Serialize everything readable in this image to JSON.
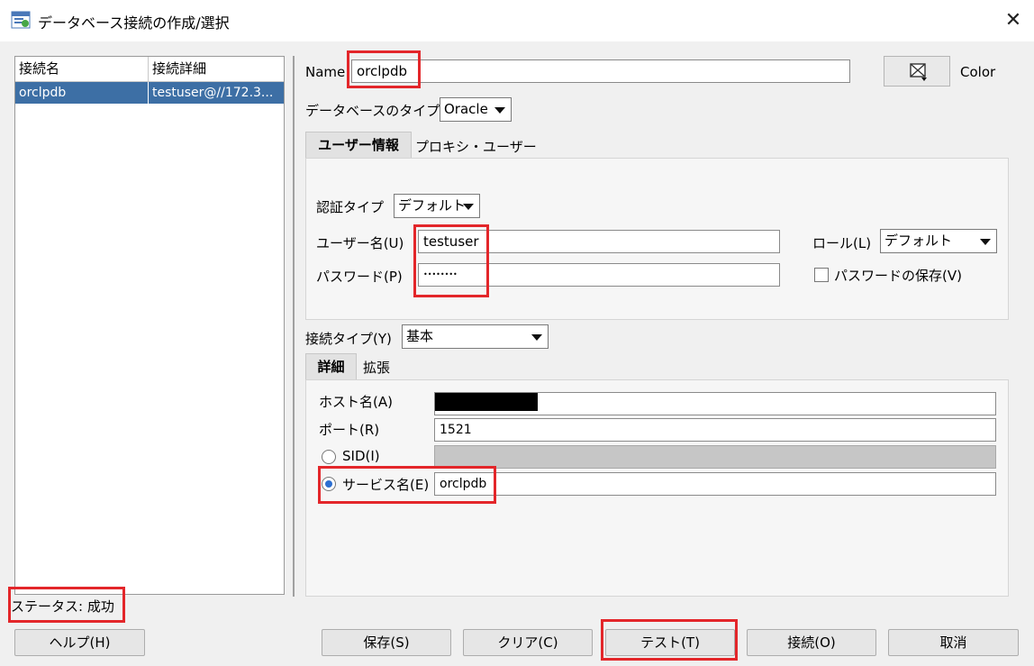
{
  "window": {
    "title": "データベース接続の作成/選択"
  },
  "list": {
    "columns": [
      "接続名",
      "接続詳細"
    ],
    "rows": [
      {
        "name": "orclpdb",
        "detail": "testuser@//172.3..."
      }
    ]
  },
  "form": {
    "name_label": "Name",
    "name_value": "orclpdb",
    "color_label": "Color",
    "db_type_label": "データベースのタイプ",
    "db_type_value": "Oracle",
    "tabs": [
      "ユーザー情報",
      "プロキシ・ユーザー"
    ],
    "auth_type_label": "認証タイプ",
    "auth_type_value": "デフォルト",
    "username_label": "ユーザー名(U)",
    "username_value": "testuser",
    "password_label": "パスワード(P)",
    "password_value": "••••••••",
    "role_label": "ロール(L)",
    "role_value": "デフォルト",
    "save_password_label": "パスワードの保存(V)",
    "conn_type_label": "接続タイプ(Y)",
    "conn_type_value": "基本",
    "detail_tabs": [
      "詳細",
      "拡張"
    ],
    "host_label": "ホスト名(A)",
    "port_label": "ポート(R)",
    "port_value": "1521",
    "sid_label": "SID(I)",
    "service_label": "サービス名(E)",
    "service_value": "orclpdb"
  },
  "status": {
    "text": "ステータス: 成功"
  },
  "buttons": {
    "help": "ヘルプ(H)",
    "save": "保存(S)",
    "clear": "クリア(C)",
    "test": "テスト(T)",
    "connect": "接続(O)",
    "cancel": "取消"
  },
  "colors": {
    "accent_red": "#e3262a",
    "selection_blue": "#3d6fa5"
  }
}
